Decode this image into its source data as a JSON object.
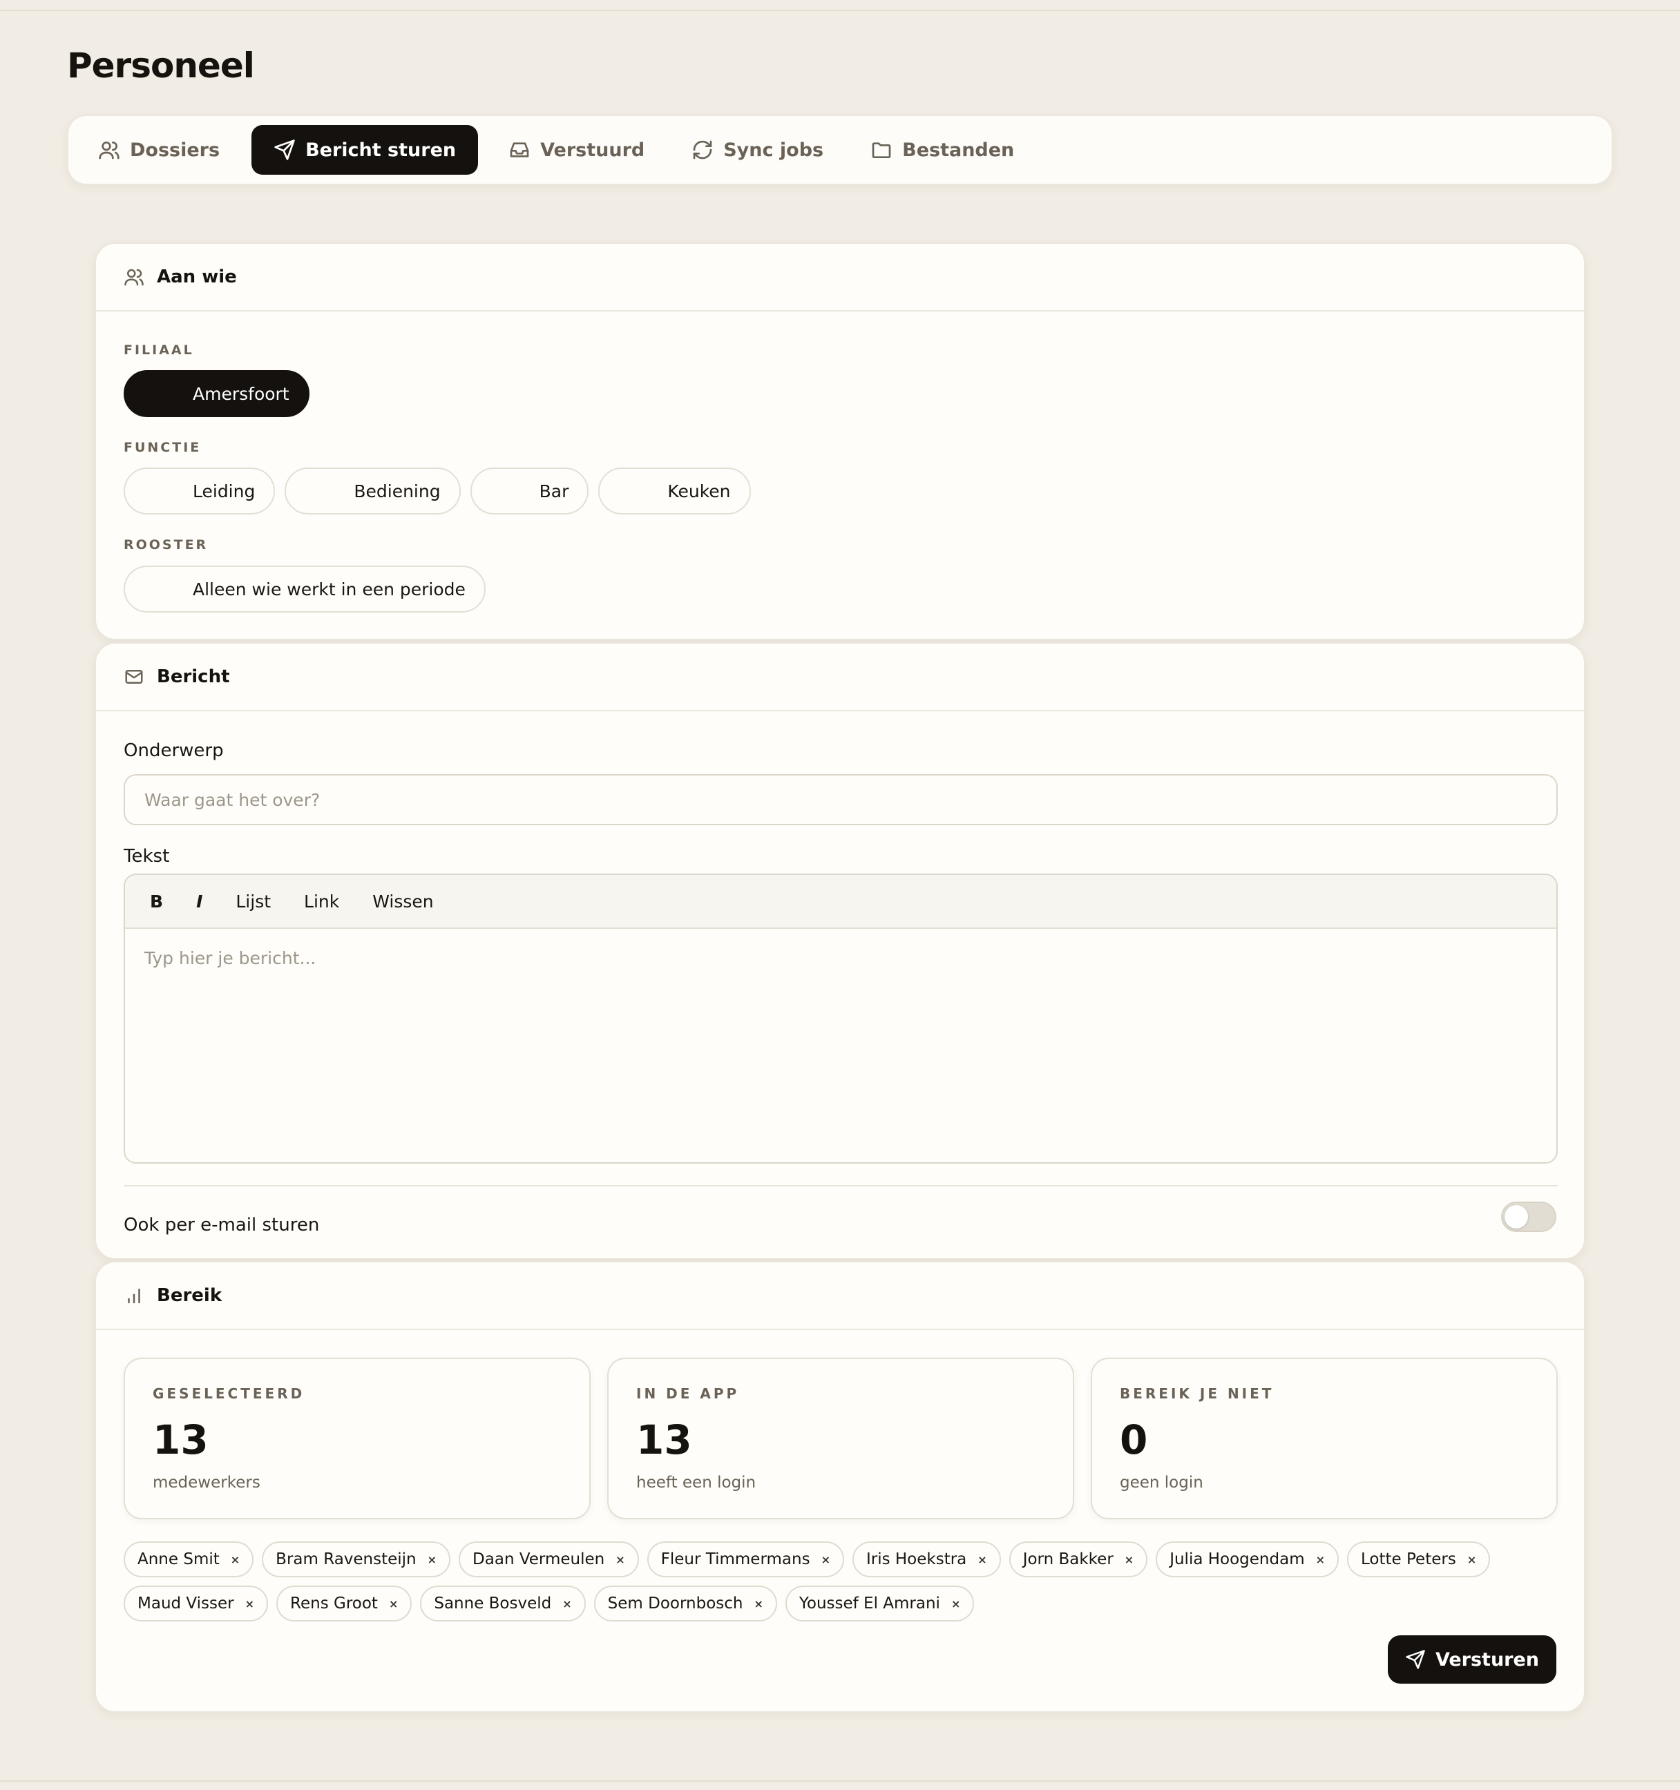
{
  "page": {
    "title": "Personeel"
  },
  "tabs": [
    {
      "label": "Dossiers",
      "icon": "users-icon"
    },
    {
      "label": "Bericht sturen",
      "icon": "send-icon",
      "active": true
    },
    {
      "label": "Verstuurd",
      "icon": "inbox-icon"
    },
    {
      "label": "Sync jobs",
      "icon": "refresh-icon"
    },
    {
      "label": "Bestanden",
      "icon": "folder-icon"
    }
  ],
  "recipients": {
    "title": "Aan wie",
    "branch": {
      "label": "FILIAAL",
      "options": [
        "Amersfoort"
      ],
      "selected": "Amersfoort"
    },
    "role": {
      "label": "FUNCTIE",
      "options": [
        "Leiding",
        "Bediening",
        "Bar",
        "Keuken"
      ]
    },
    "schedule": {
      "label": "ROOSTER",
      "options": [
        "Alleen wie werkt in een periode"
      ]
    }
  },
  "message": {
    "title": "Bericht",
    "subject_label": "Onderwerp",
    "subject_placeholder": "Waar gaat het over?",
    "text_label": "Tekst",
    "toolbar": {
      "bold": "B",
      "italic": "I",
      "list": "Lijst",
      "link": "Link",
      "clear": "Wissen"
    },
    "body_placeholder": "Typ hier je bericht...",
    "email_toggle_label": "Ook per e-mail sturen",
    "email_toggle_on": false
  },
  "reach": {
    "title": "Bereik",
    "stats": [
      {
        "label": "GESELECTEERD",
        "value": "13",
        "sub": "medewerkers"
      },
      {
        "label": "IN DE APP",
        "value": "13",
        "sub": "heeft een login"
      },
      {
        "label": "BEREIK JE NIET",
        "value": "0",
        "sub": "geen login"
      }
    ],
    "people": [
      "Anne Smit",
      "Bram Ravensteijn",
      "Daan Vermeulen",
      "Fleur Timmermans",
      "Iris Hoekstra",
      "Jorn Bakker",
      "Julia Hoogendam",
      "Lotte Peters",
      "Maud Visser",
      "Rens Groot",
      "Sanne Bosveld",
      "Sem Doornbosch",
      "Youssef El Amrani"
    ],
    "remove_glyph": "×",
    "send_label": "Versturen"
  },
  "colors": {
    "accent": "#14110e",
    "background": "#f1ede4",
    "card": "#fefdf9",
    "muted": "#6a6256"
  }
}
